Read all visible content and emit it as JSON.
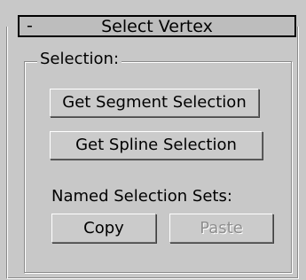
{
  "rollout": {
    "title": "Select Vertex",
    "collapse_symbol": "-"
  },
  "selection_group": {
    "label": "Selection:",
    "get_segment_selection_label": "Get Segment Selection",
    "get_spline_selection_label": "Get Spline Selection",
    "named_sets_label": "Named Selection Sets:",
    "copy_label": "Copy",
    "paste_label": "Paste",
    "paste_enabled": false
  }
}
